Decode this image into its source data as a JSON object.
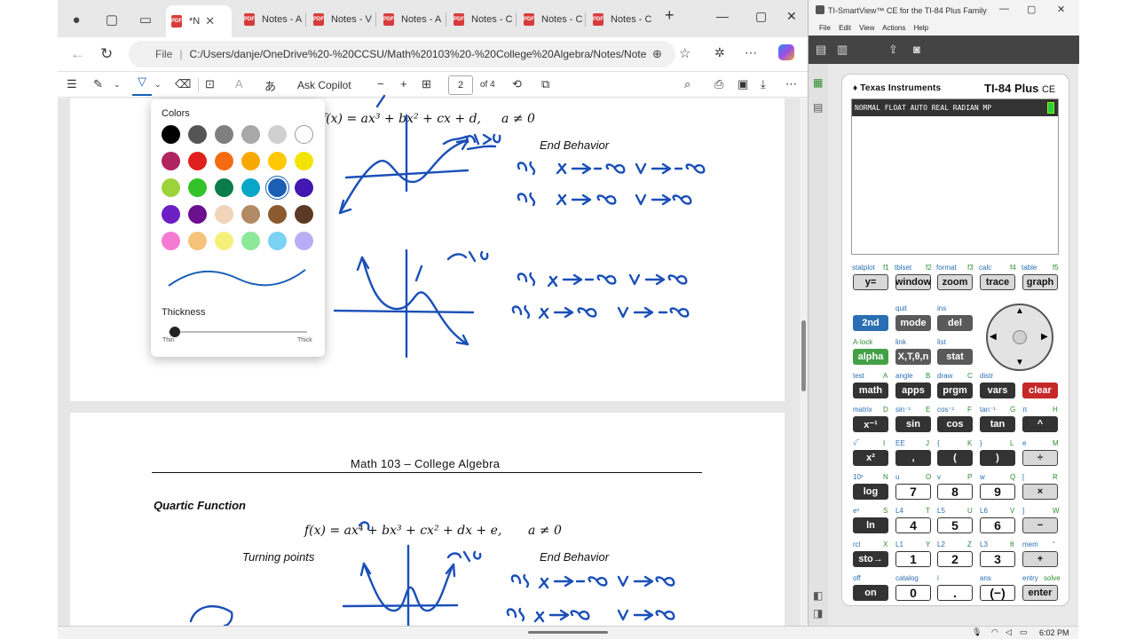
{
  "browser": {
    "tabs": [
      {
        "label": "*N",
        "active": true
      },
      {
        "label": "Notes - A"
      },
      {
        "label": "Notes - V"
      },
      {
        "label": "Notes - A"
      },
      {
        "label": "Notes - C"
      },
      {
        "label": "Notes - C"
      },
      {
        "label": "Notes - C"
      }
    ],
    "address": {
      "scheme": "File",
      "url": "C:/Users/danje/OneDrive%20-%20CCSU/Math%20103%20-%20College%20Algebra/Notes/Notes%20-%204.2..."
    },
    "pdf_toolbar": {
      "ask_copilot": "Ask Copilot",
      "zoom_minus": "−",
      "zoom_plus": "+",
      "page_current": "2",
      "page_total": "of 4"
    }
  },
  "document": {
    "cubic": {
      "formula_rest": "f(x) = ax³ + bx² + cx + d,",
      "condition": "a ≠ 0",
      "end_behavior_label": "End Behavior"
    },
    "page2": {
      "header": "Math 103 – College Algebra",
      "section_title": "Quartic Function",
      "formula": "f(x) = ax⁴ + bx³ + cx² + dx + e,",
      "condition": "a ≠ 0",
      "turning_points_label": "Turning points",
      "end_behavior_label": "End Behavior"
    }
  },
  "color_picker": {
    "title": "Colors",
    "colors": [
      [
        "#000000",
        "#555555",
        "#7f7f7f",
        "#a8a8a8",
        "#d0d0d0",
        "#ffffff"
      ],
      [
        "#b0245f",
        "#e0201c",
        "#f36b13",
        "#f7a800",
        "#ffc800",
        "#f3e300"
      ],
      [
        "#9ed23a",
        "#32c32a",
        "#0a7c4b",
        "#0aa6c8",
        "#1a5fb4",
        "#4218b0"
      ],
      [
        "#6b1fc4",
        "#6a0f8e",
        "#f2d4bb",
        "#b38a66",
        "#8c5a30",
        "#5a3a22"
      ],
      [
        "#f57ad2",
        "#f7c27a",
        "#f5f07a",
        "#8ee89a",
        "#7ad2f5",
        "#b7aef5"
      ]
    ],
    "selected": "#1a5fb4",
    "thickness_label": "Thickness",
    "thin_label": "Thin",
    "thick_label": "Thick",
    "thickness_value": 0
  },
  "ti": {
    "window_title": "TI-SmartView™ CE for the TI-84 Plus Family",
    "menu": [
      "File",
      "Edit",
      "View",
      "Actions",
      "Help"
    ],
    "brand": "Texas Instruments",
    "model": "TI-84 Plus",
    "model_suffix": "CE",
    "status": "NORMAL FLOAT AUTO REAL RADIAN MP",
    "keys": {
      "y_eq": "y=",
      "window": "window",
      "zoom": "zoom",
      "trace": "trace",
      "graph": "graph",
      "second": "2nd",
      "mode": "mode",
      "del": "del",
      "alpha": "alpha",
      "xton": "X,T,θ,n",
      "stat": "stat",
      "math": "math",
      "apps": "apps",
      "prgm": "prgm",
      "vars": "vars",
      "clear": "clear",
      "inv": "x⁻¹",
      "sin": "sin",
      "cos": "cos",
      "tan": "tan",
      "pow": "^",
      "sq": "x²",
      "comma": ",",
      "lparen": "(",
      "rparen": ")",
      "div": "÷",
      "log": "log",
      "k7": "7",
      "k8": "8",
      "k9": "9",
      "mul": "×",
      "ln": "ln",
      "k4": "4",
      "k5": "5",
      "k6": "6",
      "minus": "−",
      "sto": "sto→",
      "k1": "1",
      "k2": "2",
      "k3": "3",
      "plus": "+",
      "on": "on",
      "k0": "0",
      "dot": ".",
      "neg": "(−)",
      "enter": "enter"
    },
    "second_labels": {
      "statplot": "statplot",
      "f1": "f1",
      "tblset": "tblset",
      "f2": "f2",
      "format": "format",
      "f3": "f3",
      "calc": "calc",
      "f4": "f4",
      "table": "table",
      "f5": "f5",
      "quit": "quit",
      "ins": "ins",
      "alock": "A-lock",
      "link": "link",
      "list": "list",
      "test": "test",
      "A": "A",
      "angle": "angle",
      "B": "B",
      "draw": "draw",
      "C": "C",
      "distr": "distr",
      "matrix": "matrix",
      "D": "D",
      "sininv": "sin⁻¹",
      "E": "E",
      "cosinv": "cos⁻¹",
      "F": "F",
      "taninv": "tan⁻¹",
      "G": "G",
      "pi": "π",
      "H": "H",
      "sqrt": "√‾",
      "I": "I",
      "EE": "EE",
      "J": "J",
      "lbrace": "{",
      "K": "K",
      "rbrace": "}",
      "L": "L",
      "e": "e",
      "M": "M",
      "tenx": "10ˣ",
      "N": "N",
      "u": "u",
      "O": "O",
      "v": "v",
      "P": "P",
      "w": "w",
      "Q": "Q",
      "lbrack": "[",
      "R": "R",
      "ex": "eˣ",
      "S": "S",
      "L4": "L4",
      "T": "T",
      "L5": "L5",
      "U": "U",
      "L6": "L6",
      "V": "V",
      "rbrack": "]",
      "W": "W",
      "rcl": "rcl",
      "X": "X",
      "L1": "L1",
      "Y": "Y",
      "L2": "L2",
      "Z": "Z",
      "L3": "L3",
      "theta": "θ",
      "mem": "mem",
      "quote": "“",
      "off": "off",
      "catalog": "catalog",
      "i": "i",
      "ans": "ans",
      "entry": "entry",
      "solve": "solve"
    }
  },
  "taskbar": {
    "time": "6:02 PM"
  }
}
